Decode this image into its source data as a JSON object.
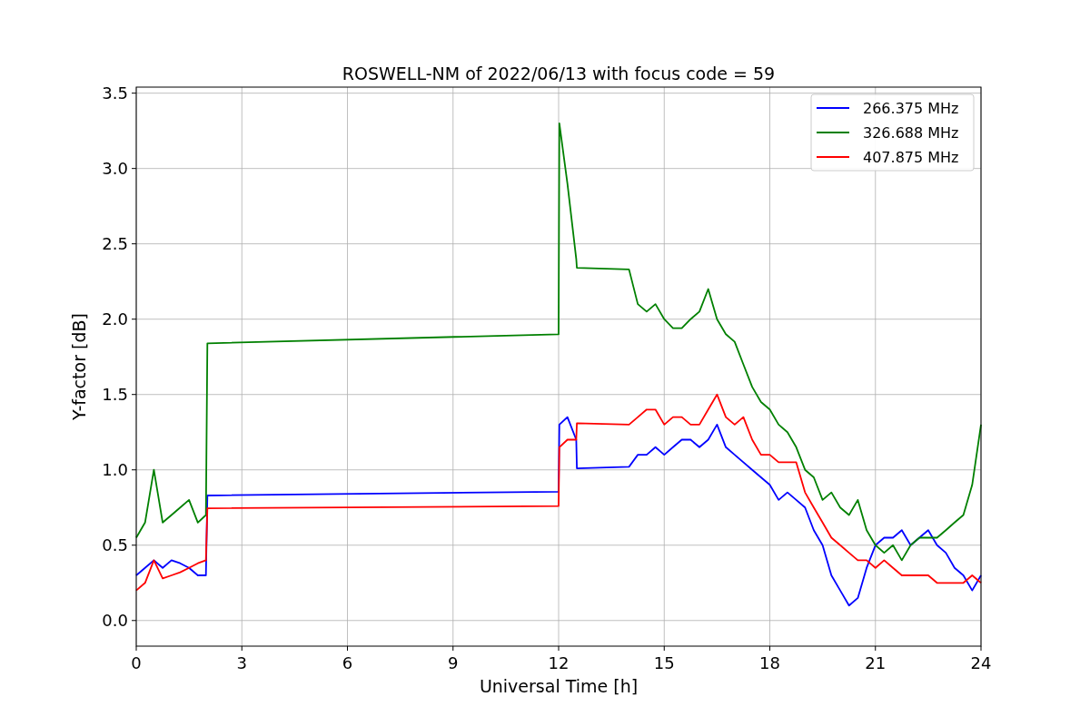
{
  "chart_data": {
    "type": "line",
    "title": "ROSWELL-NM of 2022/06/13 with focus code = 59",
    "xlabel": "Universal Time [h]",
    "ylabel": "Y-factor [dB]",
    "x": [
      0,
      0.25,
      0.5,
      0.75,
      1,
      1.25,
      1.5,
      1.75,
      1.98,
      2.02,
      12,
      12.02,
      12.25,
      12.5,
      12.52,
      14,
      14.25,
      14.5,
      14.75,
      15,
      15.25,
      15.5,
      15.75,
      16,
      16.25,
      16.5,
      16.75,
      17,
      17.25,
      17.5,
      17.75,
      18,
      18.25,
      18.5,
      18.75,
      19,
      19.25,
      19.5,
      19.75,
      20,
      20.25,
      20.5,
      20.75,
      21,
      21.25,
      21.5,
      21.75,
      22,
      22.25,
      22.5,
      22.75,
      23,
      23.25,
      23.5,
      23.75,
      24
    ],
    "series": [
      {
        "name": "266.375 MHz",
        "color": "#0000ff",
        "values": [
          0.3,
          0.35,
          0.4,
          0.35,
          0.4,
          0.38,
          0.35,
          0.3,
          0.3,
          0.83,
          0.855,
          1.3,
          1.35,
          1.2,
          1.01,
          1.02,
          1.1,
          1.1,
          1.15,
          1.1,
          1.15,
          1.2,
          1.2,
          1.15,
          1.2,
          1.3,
          1.15,
          1.1,
          1.05,
          1.0,
          0.95,
          0.9,
          0.8,
          0.85,
          0.8,
          0.75,
          0.6,
          0.5,
          0.3,
          0.2,
          0.1,
          0.15,
          0.35,
          0.5,
          0.55,
          0.55,
          0.6,
          0.5,
          0.55,
          0.6,
          0.5,
          0.45,
          0.35,
          0.3,
          0.2,
          0.3
        ]
      },
      {
        "name": "326.688 MHz",
        "color": "#008000",
        "values": [
          0.55,
          0.65,
          1.0,
          0.65,
          0.7,
          0.75,
          0.8,
          0.65,
          0.7,
          1.84,
          1.9,
          3.3,
          2.9,
          2.4,
          2.34,
          2.33,
          2.1,
          2.05,
          2.1,
          2.0,
          1.94,
          1.94,
          2.0,
          2.05,
          2.2,
          2.0,
          1.9,
          1.85,
          1.7,
          1.55,
          1.45,
          1.4,
          1.3,
          1.25,
          1.15,
          1.0,
          0.95,
          0.8,
          0.85,
          0.75,
          0.7,
          0.8,
          0.6,
          0.5,
          0.45,
          0.5,
          0.4,
          0.5,
          0.55,
          0.55,
          0.55,
          0.6,
          0.65,
          0.7,
          0.9,
          1.3
        ]
      },
      {
        "name": "407.875 MHz",
        "color": "#ff0000",
        "values": [
          0.2,
          0.25,
          0.4,
          0.28,
          0.3,
          0.32,
          0.35,
          0.38,
          0.4,
          0.745,
          0.76,
          1.15,
          1.2,
          1.2,
          1.31,
          1.3,
          1.35,
          1.4,
          1.4,
          1.3,
          1.35,
          1.35,
          1.3,
          1.3,
          1.4,
          1.5,
          1.35,
          1.3,
          1.35,
          1.2,
          1.1,
          1.1,
          1.05,
          1.05,
          1.05,
          0.85,
          0.75,
          0.65,
          0.55,
          0.5,
          0.45,
          0.4,
          0.4,
          0.35,
          0.4,
          0.35,
          0.3,
          0.3,
          0.3,
          0.3,
          0.25,
          0.25,
          0.25,
          0.25,
          0.3,
          0.25
        ]
      }
    ],
    "grid": true,
    "legend": true,
    "xlim": [
      0,
      24
    ],
    "ylim": [
      -0.17,
      3.54
    ],
    "xticks": [
      0,
      3,
      6,
      9,
      12,
      15,
      18,
      21,
      24
    ],
    "yticks": [
      {
        "value": 0,
        "label": "0.0"
      },
      {
        "value": 0.5,
        "label": "0.5"
      },
      {
        "value": 1,
        "label": "1.0"
      },
      {
        "value": 1.5,
        "label": "1.5"
      },
      {
        "value": 2,
        "label": "2.0"
      },
      {
        "value": 2.5,
        "label": "2.5"
      },
      {
        "value": 3,
        "label": "3.0"
      },
      {
        "value": 3.5,
        "label": "3.5"
      }
    ]
  }
}
